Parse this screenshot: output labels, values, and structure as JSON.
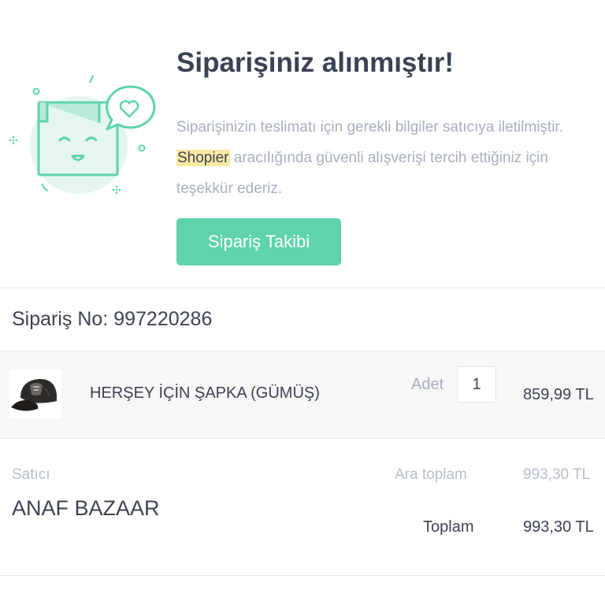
{
  "header": {
    "title": "Siparişiniz alınmıştır!",
    "description_line1": "Siparişinizin teslimatı için gerekli bilgiler satıcıya iletilmiştir.",
    "brand": "Shopier",
    "description_line2_rest": " aracılığında güvenli alışverişi tercih ettiğiniz için",
    "description_line3": "teşekkür ederiz.",
    "track_button_label": "Sipariş Takibi"
  },
  "order": {
    "number_label": "Sipariş No: 997220286"
  },
  "items": [
    {
      "name": "HERŞEY İÇİN ŞAPKA (GÜMÜŞ)",
      "qty_label": "Adet",
      "qty": "1",
      "price": "859,99 TL"
    }
  ],
  "seller": {
    "label": "Satıcı",
    "name": "ANAF BAZAAR"
  },
  "summary": {
    "subtotal_label": "Ara toplam",
    "subtotal_value": "993,30 TL",
    "total_label": "Toplam",
    "total_value": "993,30 TL"
  },
  "colors": {
    "accent": "#5ed3ac",
    "title": "#3a4254",
    "muted_text": "#a7afbe",
    "brand_highlight": "#fde9a4"
  },
  "icons": {
    "illustration": "happy-package-with-heart-bubble-icon",
    "product_thumbnail": "black-cap-image"
  }
}
